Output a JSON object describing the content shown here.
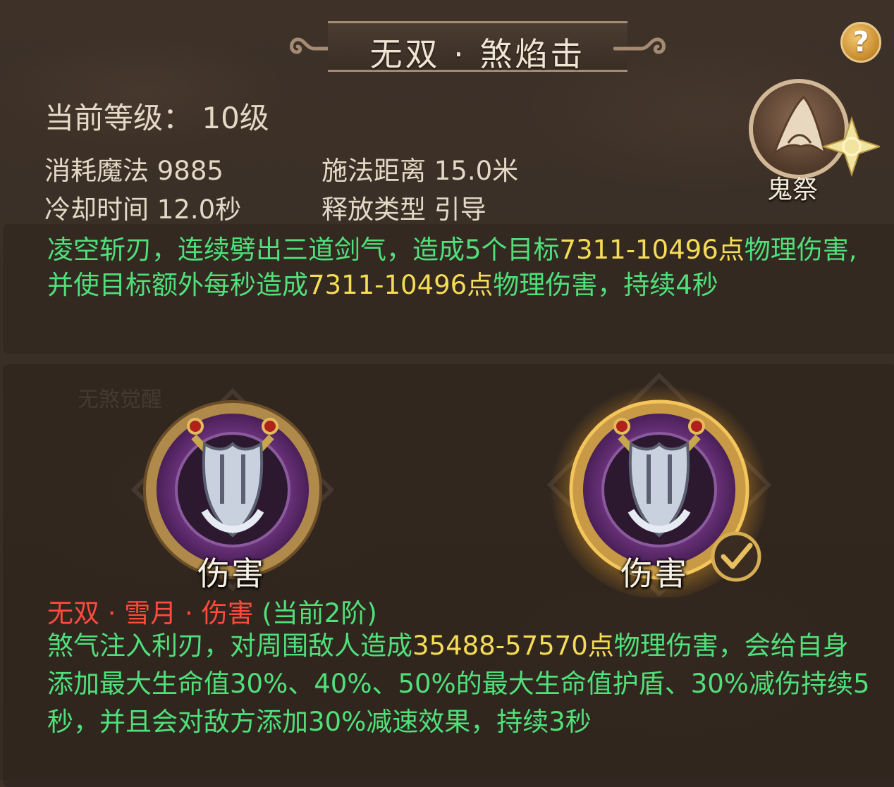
{
  "skill": {
    "title": "无双 · 煞焰击",
    "help_icon": "?",
    "level": "当前等级：  10级",
    "mana": "消耗魔法 9885",
    "range": "施法距离 15.0米",
    "cooldown": "冷却时间 12.0秒",
    "cast_type": "释放类型 引导",
    "school_badge": "鬼祭",
    "description": {
      "p1": "凌空斩刃，连续劈出三道剑气，造成5个目标",
      "v1": "7311-10496点",
      "p2": "物理伤害,并使目标额外每秒造成",
      "v2": "7311-10496点",
      "p3": "物理伤害，持续4秒"
    }
  },
  "upgrade": {
    "ghost_label": "无煞觉醒",
    "options": [
      {
        "label": "伤害",
        "selected": false
      },
      {
        "label": "伤害",
        "selected": true
      }
    ],
    "current_title": "无双 · 雪月 · 伤害",
    "current_stage": "(当前2阶)",
    "description": {
      "p1": "煞气注入利刃，对周围敌人造成",
      "v1": "35488-57570点",
      "p2": "物理伤害，会给自身添加最大生命值30%、40%、50%的最大生命值护盾、30%减伤持续5秒，并且会对敌方添加30%减速效果，持续3秒"
    }
  },
  "colors": {
    "effect_text": "#4fe07a",
    "value_text": "#f5dc57",
    "title_red": "#ff4a3e"
  }
}
